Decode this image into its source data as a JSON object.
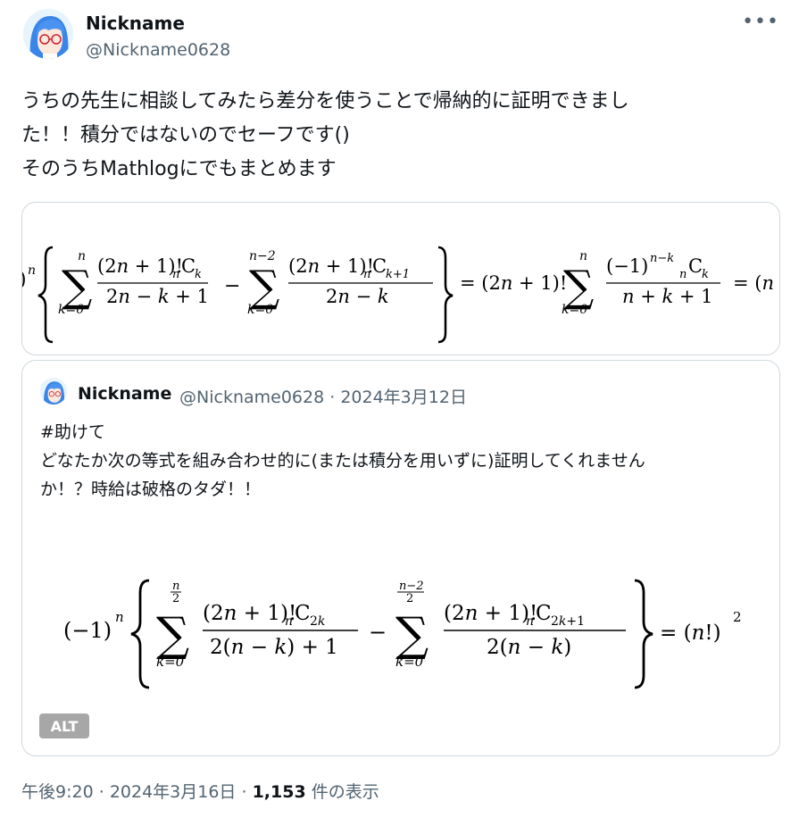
{
  "author": {
    "name": "Nickname",
    "handle": "@Nickname0628",
    "more_icon": "more-horizontal-icon"
  },
  "tweet": {
    "text_lines": [
      "うちの先生に相談してみたら差分を使うことで帰納的に証明できまし",
      "た！！積分ではないのでセーフです()",
      "そのうちMathlogにでもまとめます"
    ]
  },
  "media": {
    "formula_image": "formula-image-cropped"
  },
  "quote": {
    "name": "Nickname",
    "handle": "@Nickname0628",
    "separator": "·",
    "date": "2024年3月12日",
    "text_lines": [
      "#助けて",
      "どなたか次の等式を組み合わせ的に(または積分を用いずに)証明してくれません",
      "か！？時給は破格のタダ！！"
    ],
    "alt_label": "ALT"
  },
  "footer": {
    "time": "午後9:20",
    "sep1": "·",
    "date": "2024年3月16日",
    "sep2": "·",
    "views": "1,153",
    "views_suffix": "件の表示"
  }
}
